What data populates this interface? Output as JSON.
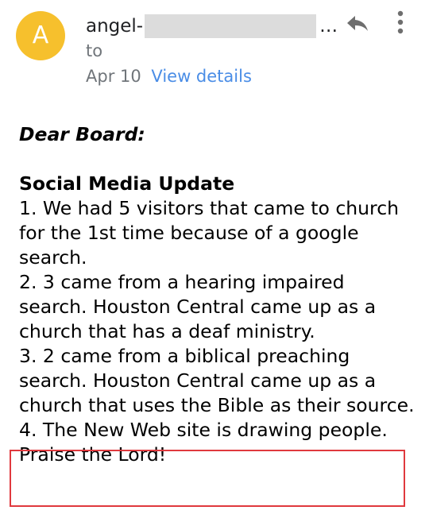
{
  "header": {
    "avatar_letter": "A",
    "avatar_color": "#f6c02d",
    "sender_name": "angel-",
    "sender_ellipsis": "…",
    "to_label": "to",
    "date": "Apr 10",
    "view_details_label": "View details",
    "link_color": "#4a8de6",
    "reply_icon": "reply-icon",
    "more_icon": "more-vertical-icon"
  },
  "message": {
    "greeting": "Dear Board:",
    "section_title": "Social Media Update",
    "items": [
      "1. We had 5 visitors that came to church for the 1st time because of a google search.",
      "2. 3 came from a hearing impaired search. Houston Central came up as a church that has a deaf ministry.",
      "3. 2 came from a biblical preaching search. Houston Central came up as a church that uses the Bible as their source.",
      "4. The New Web site is drawing people. Praise the Lord!"
    ],
    "highlight_color": "#e0393e"
  }
}
